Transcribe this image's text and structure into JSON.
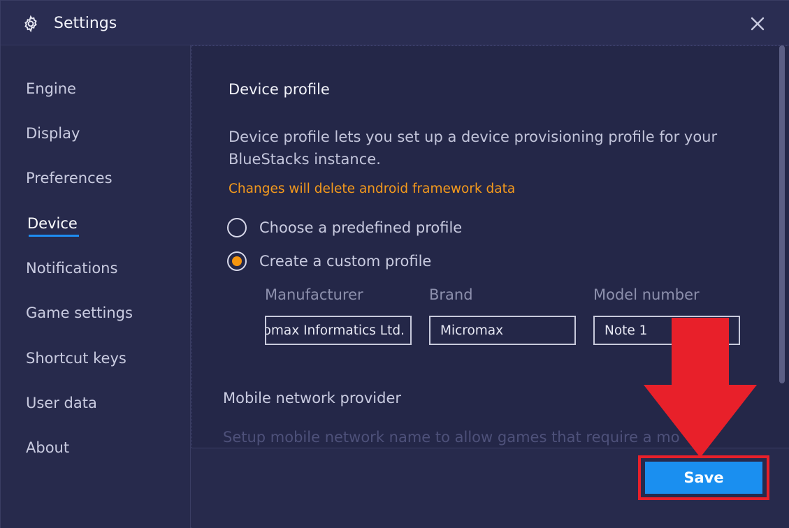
{
  "window": {
    "title": "Settings",
    "title_icon": "gear-icon",
    "close_icon": "close-icon"
  },
  "sidebar": {
    "items": [
      {
        "label": "Engine"
      },
      {
        "label": "Display"
      },
      {
        "label": "Preferences"
      },
      {
        "label": "Device",
        "active": true
      },
      {
        "label": "Notifications"
      },
      {
        "label": "Game settings"
      },
      {
        "label": "Shortcut keys"
      },
      {
        "label": "User data"
      },
      {
        "label": "About"
      }
    ]
  },
  "device_profile": {
    "title": "Device profile",
    "description": "Device profile lets you set up a device provisioning profile for your BlueStacks instance.",
    "warning": "Changes will delete android framework data",
    "options": [
      {
        "label": "Choose a predefined profile",
        "checked": false
      },
      {
        "label": "Create a custom profile",
        "checked": true
      }
    ],
    "fields": {
      "manufacturer": {
        "label": "Manufacturer",
        "value": "omax Informatics Ltd."
      },
      "brand": {
        "label": "Brand",
        "value": "Micromax"
      },
      "model": {
        "label": "Model number",
        "value": "Note 1"
      }
    }
  },
  "mobile_network": {
    "title": "Mobile network provider",
    "description": "Setup mobile network name to allow games that require a mo"
  },
  "footer": {
    "save_label": "Save"
  },
  "colors": {
    "accent_blue": "#1a8ff0",
    "warning_orange": "#f59a1c",
    "highlight_red": "#e8202a"
  }
}
